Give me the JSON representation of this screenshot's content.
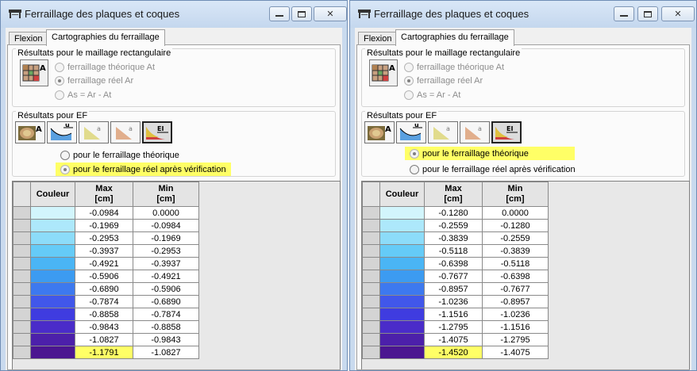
{
  "colors": {
    "highlight": "#ffff66",
    "scale": [
      "#d2f5fc",
      "#ade8fb",
      "#8cdcf9",
      "#65cbf7",
      "#4ab5f5",
      "#3c9bf1",
      "#3d79ef",
      "#4157ea",
      "#3f3ce0",
      "#4a2cc9",
      "#4c20aa",
      "#4b1690"
    ]
  },
  "windows": [
    {
      "title": "Ferraillage des plaques et coques",
      "tabs": [
        "Flexion",
        "Cartographies du ferraillage"
      ],
      "rect_group": {
        "title": "Résultats pour le maillage rectangulaire",
        "options": [
          "ferraillage théorique At",
          "ferraillage réel Ar",
          "As = Ar - At"
        ]
      },
      "ef_group": {
        "title": "Résultats pour EF",
        "options": [
          "pour le ferraillage théorique",
          "pour le ferraillage réel après vérification"
        ],
        "selected_index": 1
      },
      "table": {
        "headers": {
          "color": "Couleur",
          "max": "Max\n[cm]",
          "min": "Min\n[cm]"
        },
        "rows": [
          {
            "max": "-0.0984",
            "min": "0.0000"
          },
          {
            "max": "-0.1969",
            "min": "-0.0984"
          },
          {
            "max": "-0.2953",
            "min": "-0.1969"
          },
          {
            "max": "-0.3937",
            "min": "-0.2953"
          },
          {
            "max": "-0.4921",
            "min": "-0.3937"
          },
          {
            "max": "-0.5906",
            "min": "-0.4921"
          },
          {
            "max": "-0.6890",
            "min": "-0.5906"
          },
          {
            "max": "-0.7874",
            "min": "-0.6890"
          },
          {
            "max": "-0.8858",
            "min": "-0.7874"
          },
          {
            "max": "-0.9843",
            "min": "-0.8858"
          },
          {
            "max": "-1.0827",
            "min": "-0.9843"
          },
          {
            "max": "-1.1791",
            "min": "-1.0827"
          }
        ]
      }
    },
    {
      "title": "Ferraillage des plaques et coques",
      "tabs": [
        "Flexion",
        "Cartographies du ferraillage"
      ],
      "rect_group": {
        "title": "Résultats pour le maillage rectangulaire",
        "options": [
          "ferraillage théorique At",
          "ferraillage réel Ar",
          "As = Ar - At"
        ]
      },
      "ef_group": {
        "title": "Résultats pour EF",
        "options": [
          "pour le ferraillage théorique",
          "pour le ferraillage réel après vérification"
        ],
        "selected_index": 0
      },
      "table": {
        "headers": {
          "color": "Couleur",
          "max": "Max\n[cm]",
          "min": "Min\n[cm]"
        },
        "rows": [
          {
            "max": "-0.1280",
            "min": "0.0000"
          },
          {
            "max": "-0.2559",
            "min": "-0.1280"
          },
          {
            "max": "-0.3839",
            "min": "-0.2559"
          },
          {
            "max": "-0.5118",
            "min": "-0.3839"
          },
          {
            "max": "-0.6398",
            "min": "-0.5118"
          },
          {
            "max": "-0.7677",
            "min": "-0.6398"
          },
          {
            "max": "-0.8957",
            "min": "-0.7677"
          },
          {
            "max": "-1.0236",
            "min": "-0.8957"
          },
          {
            "max": "-1.1516",
            "min": "-1.0236"
          },
          {
            "max": "-1.2795",
            "min": "-1.1516"
          },
          {
            "max": "-1.4075",
            "min": "-1.2795"
          },
          {
            "max": "-1.4520",
            "min": "-1.4075"
          }
        ]
      }
    }
  ]
}
